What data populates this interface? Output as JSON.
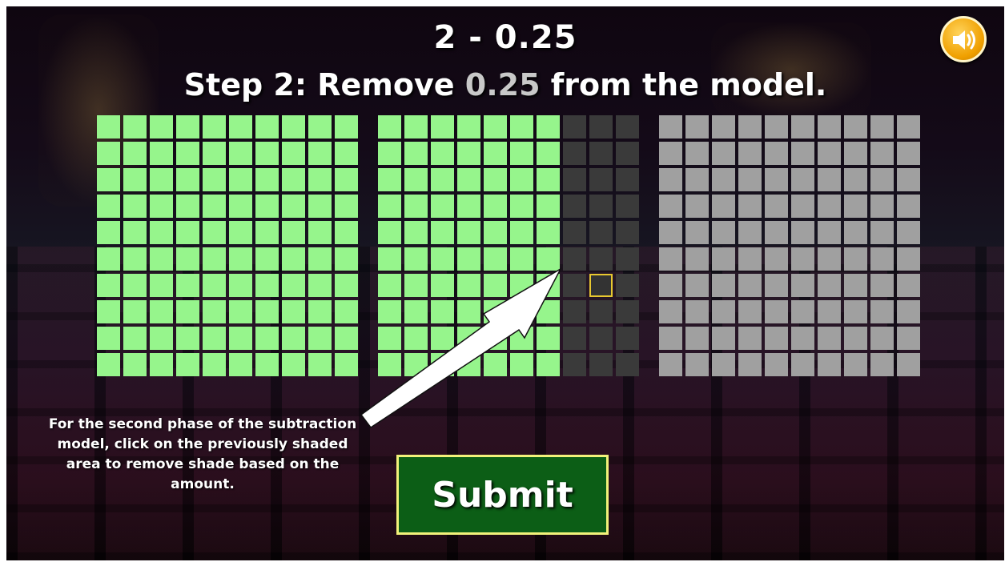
{
  "header": {
    "equation": "2 - 0.25",
    "step_prefix": "Step 2: Remove ",
    "step_amount": "0.25",
    "step_suffix": " from the model."
  },
  "sound_button": {
    "icon": "speaker-icon"
  },
  "models": [
    {
      "state": "shaded",
      "color": "#96f58c",
      "shaded_hundredths": 100,
      "removed_hundredths": 0
    },
    {
      "state": "partially-removed",
      "color": "#96f58c",
      "removed_color": "#3a3a3a",
      "shaded_hundredths": 75,
      "removed_hundredths": 25,
      "selected_cell": {
        "row": 6,
        "col": 8
      }
    },
    {
      "state": "unshaded",
      "color": "#a0a0a0",
      "shaded_hundredths": 0,
      "removed_hundredths": 0
    }
  ],
  "instruction": {
    "text": "For the second phase of the subtraction model, click on the previously shaded area to remove shade based on the amount."
  },
  "submit": {
    "label": "Submit"
  },
  "colors": {
    "accent_button": "#0c5e16",
    "button_border": "#f2f27a",
    "selection_border": "#e8c830"
  }
}
